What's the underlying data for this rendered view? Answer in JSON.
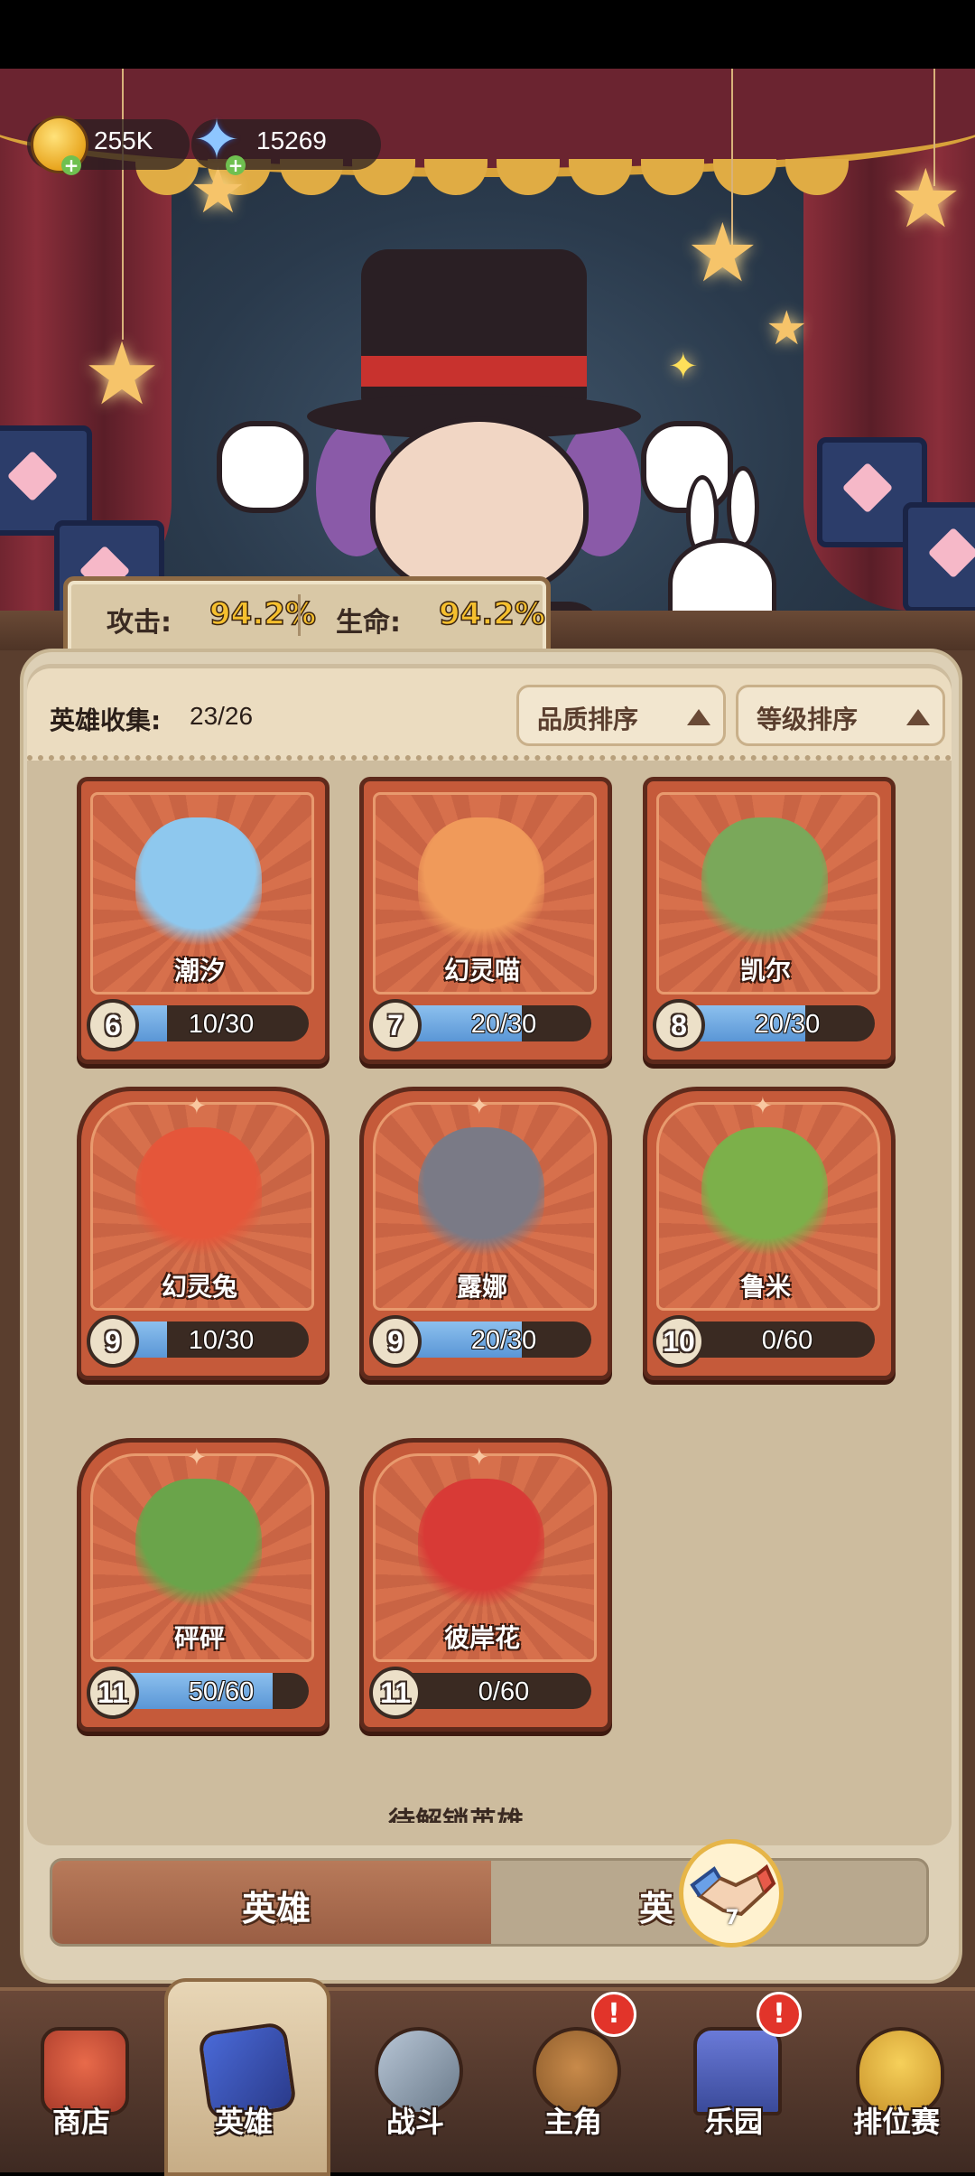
{
  "currency": {
    "coins": "255K",
    "stars": "15269"
  },
  "stats": {
    "attack_label": "攻击:",
    "attack_value": "94.2%",
    "hp_label": "生命:",
    "hp_value": "94.2%"
  },
  "collection": {
    "label": "英雄收集:",
    "value": "23/26"
  },
  "sort": {
    "quality": "品质排序",
    "level": "等级排序"
  },
  "heroes": [
    {
      "name": "潮汐",
      "level": "6",
      "progress": "10/30",
      "fill": 0.33,
      "color": "#8ec8ee"
    },
    {
      "name": "幻灵喵",
      "level": "7",
      "progress": "20/30",
      "fill": 0.67,
      "color": "#f09a5a"
    },
    {
      "name": "凯尔",
      "level": "8",
      "progress": "20/30",
      "fill": 0.67,
      "color": "#7aa85a"
    },
    {
      "name": "幻灵兔",
      "level": "9",
      "progress": "10/30",
      "fill": 0.33,
      "color": "#e5563a"
    },
    {
      "name": "露娜",
      "level": "9",
      "progress": "20/30",
      "fill": 0.67,
      "color": "#7a7a86"
    },
    {
      "name": "鲁米",
      "level": "10",
      "progress": "0/60",
      "fill": 0,
      "color": "#7cb04a"
    },
    {
      "name": "砰砰",
      "level": "11",
      "progress": "50/60",
      "fill": 0.83,
      "color": "#6aa44a"
    },
    {
      "name": "彼岸花",
      "level": "11",
      "progress": "0/60",
      "fill": 0,
      "color": "#d83a36"
    }
  ],
  "partial_label": "待解锁英雄",
  "tabs": {
    "hero": "英雄",
    "second": "英"
  },
  "handshake_badge": "7",
  "nav": [
    {
      "label": "商店",
      "icon": "shop-icon"
    },
    {
      "label": "英雄",
      "icon": "cards-icon"
    },
    {
      "label": "战斗",
      "icon": "battle-icon"
    },
    {
      "label": "主角",
      "icon": "owl-icon"
    },
    {
      "label": "乐园",
      "icon": "castle-icon"
    },
    {
      "label": "排位赛",
      "icon": "rank-icon"
    }
  ]
}
